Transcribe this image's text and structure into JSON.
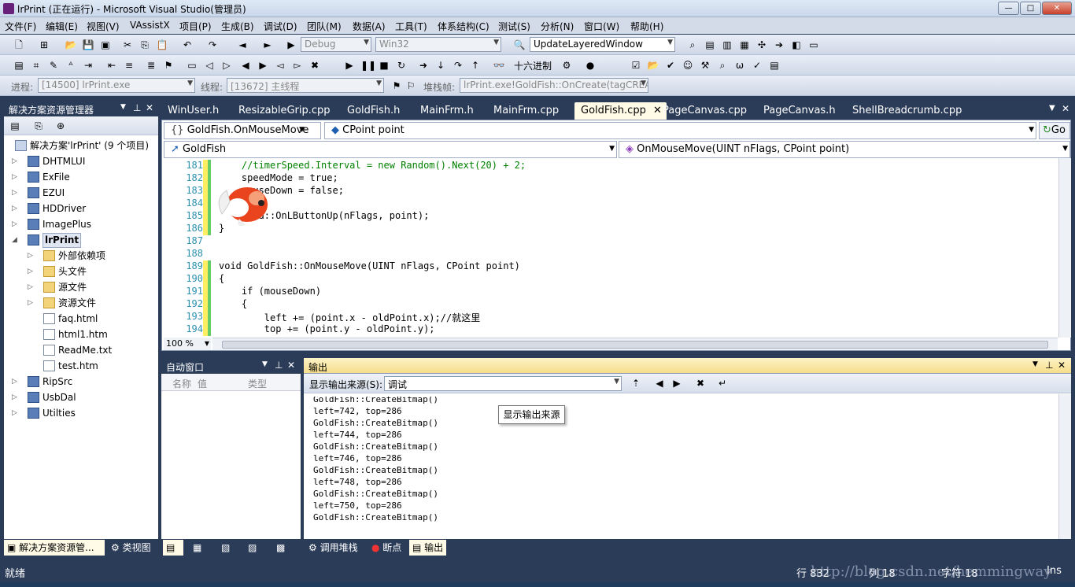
{
  "window": {
    "title": "lrPrint (正在运行) - Microsoft Visual Studio(管理员)",
    "min": "—",
    "max": "□",
    "close": "✕"
  },
  "menu": [
    "文件(F)",
    "编辑(E)",
    "视图(V)",
    "VAssistX",
    "项目(P)",
    "生成(B)",
    "调试(D)",
    "团队(M)",
    "数据(A)",
    "工具(T)",
    "体系结构(C)",
    "测试(S)",
    "分析(N)",
    "窗口(W)",
    "帮助(H)"
  ],
  "toolbar1": {
    "config": "Debug",
    "platform": "Win32",
    "find": "UpdateLayeredWindow"
  },
  "toolbar2": {
    "hex_label": "十六进制"
  },
  "toolbar3": {
    "process_label": "进程:",
    "process": "[14500] lrPrint.exe",
    "thread_label": "线程:",
    "thread": "[13672] 主线程",
    "stack_label": "堆栈帧:",
    "stack": "lrPrint.exe!GoldFish::OnCreate(tagCREA"
  },
  "solution": {
    "header": "解决方案资源管理器",
    "root": "解决方案'lrPrint' (9 个项目)",
    "items": [
      {
        "label": "DHTMLUI",
        "kind": "proj",
        "level": 1,
        "ex": "▷"
      },
      {
        "label": "ExFile",
        "kind": "proj",
        "level": 1,
        "ex": "▷"
      },
      {
        "label": "EZUI",
        "kind": "proj",
        "level": 1,
        "ex": "▷"
      },
      {
        "label": "HDDriver",
        "kind": "proj",
        "level": 1,
        "ex": "▷"
      },
      {
        "label": "ImagePlus",
        "kind": "proj",
        "level": 1,
        "ex": "▷"
      },
      {
        "label": "lrPrint",
        "kind": "proj",
        "level": 1,
        "ex": "◢"
      },
      {
        "label": "外部依赖项",
        "kind": "fold",
        "level": 2,
        "ex": "▷"
      },
      {
        "label": "头文件",
        "kind": "fold",
        "level": 2,
        "ex": "▷"
      },
      {
        "label": "源文件",
        "kind": "fold",
        "level": 2,
        "ex": "▷"
      },
      {
        "label": "资源文件",
        "kind": "fold",
        "level": 2,
        "ex": "▷"
      },
      {
        "label": "faq.html",
        "kind": "file",
        "level": 2,
        "ex": ""
      },
      {
        "label": "html1.htm",
        "kind": "file",
        "level": 2,
        "ex": ""
      },
      {
        "label": "ReadMe.txt",
        "kind": "file",
        "level": 2,
        "ex": ""
      },
      {
        "label": "test.htm",
        "kind": "file",
        "level": 2,
        "ex": ""
      },
      {
        "label": "RipSrc",
        "kind": "proj",
        "level": 1,
        "ex": "▷"
      },
      {
        "label": "UsbDal",
        "kind": "proj",
        "level": 1,
        "ex": "▷"
      },
      {
        "label": "Utilties",
        "kind": "proj",
        "level": 1,
        "ex": "▷"
      }
    ]
  },
  "tabs": [
    "WinUser.h",
    "ResizableGrip.cpp",
    "GoldFish.h",
    "MainFrm.h",
    "MainFrm.cpp",
    "GoldFish.cpp",
    "PageCanvas.cpp",
    "PageCanvas.h",
    "ShellBreadcrumb.cpp"
  ],
  "editor": {
    "nav1": "GoldFish.OnMouseMove",
    "nav2": "CPoint point",
    "go": "Go",
    "class": "GoldFish",
    "method": "OnMouseMove(UINT nFlags, CPoint point)",
    "zoom": "100 %",
    "lines": [
      {
        "n": "181",
        "t": "    //timerSpeed.Interval = new Random().Next(20) + 2;"
      },
      {
        "n": "182",
        "t": "    speedMode = true;"
      },
      {
        "n": "183",
        "t": "    mouseDown = false;"
      },
      {
        "n": "184",
        "t": ""
      },
      {
        "n": "185",
        "t": "    CWnd::OnLButtonUp(nFlags, point);"
      },
      {
        "n": "186",
        "t": "}"
      },
      {
        "n": "187",
        "t": ""
      },
      {
        "n": "188",
        "t": ""
      },
      {
        "n": "189",
        "t": "void GoldFish::OnMouseMove(UINT nFlags, CPoint point)"
      },
      {
        "n": "190",
        "t": "{"
      },
      {
        "n": "191",
        "t": "    if (mouseDown)"
      },
      {
        "n": "192",
        "t": "    {"
      },
      {
        "n": "193",
        "t": "        left += (point.x - oldPoint.x);//就这里"
      },
      {
        "n": "194",
        "t": "        top += (point.y - oldPoint.y);"
      }
    ]
  },
  "autos": {
    "header": "自动窗口",
    "col_name": "名称",
    "col_value": "值",
    "col_type": "类型"
  },
  "output": {
    "header": "输出",
    "source_label": "显示输出来源(S):",
    "source": "调试",
    "tooltip": "显示输出来源",
    "lines": [
      "GoldFish::CreateBitmap()",
      "left=742, top=286",
      "GoldFish::CreateBitmap()",
      "left=744, top=286",
      "GoldFish::CreateBitmap()",
      "left=746, top=286",
      "GoldFish::CreateBitmap()",
      "left=748, top=286",
      "GoldFish::CreateBitmap()",
      "left=750, top=286",
      "GoldFish::CreateBitmap()"
    ]
  },
  "bottom_tabs": {
    "sol": "解决方案资源管...",
    "cls": "类视图",
    "callstack": "调用堆栈",
    "bp": "断点",
    "out": "输出"
  },
  "status": {
    "ready": "就绪",
    "line": "行 832",
    "col": "列 18",
    "char": "字符 18",
    "ins": "Ins",
    "watermark": "http://blog.csdn.net/hemmingway"
  },
  "colors": {
    "accent": "#2b3c59",
    "active_tab": "#fffbe6",
    "line_yellow": "#ffee62"
  }
}
